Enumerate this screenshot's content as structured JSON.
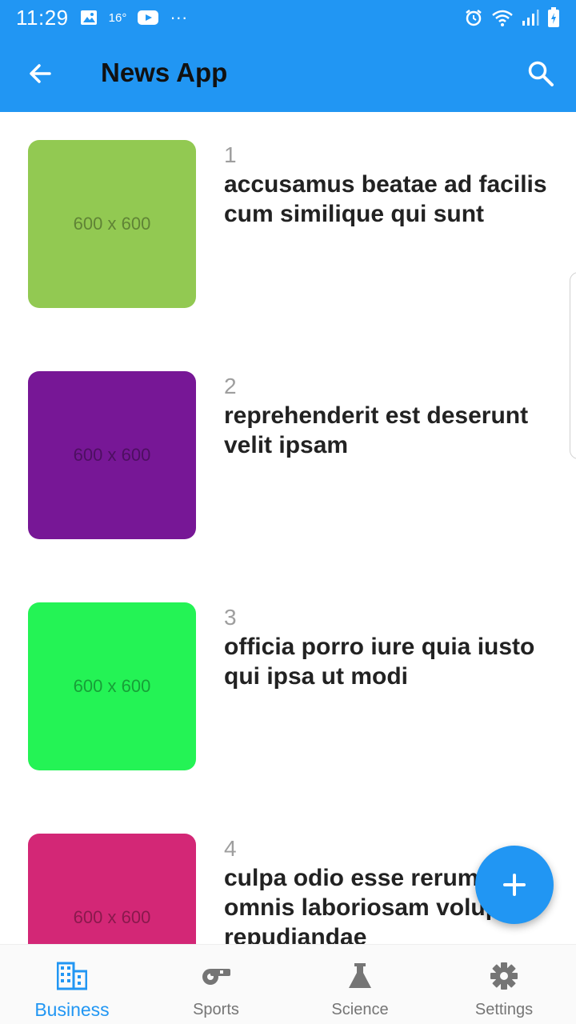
{
  "status_bar": {
    "time": "11:29",
    "temp": "16°",
    "dots": "···"
  },
  "app_bar": {
    "title": "News App"
  },
  "news": [
    {
      "number": "1",
      "title": "accusamus beatae ad facilis cum similique qui sunt",
      "thumb_text": "600 x 600",
      "thumb_color": "#92c952"
    },
    {
      "number": "2",
      "title": "reprehenderit est deserunt velit ipsam",
      "thumb_text": "600 x 600",
      "thumb_color": "#771796"
    },
    {
      "number": "3",
      "title": "officia porro iure quia iusto qui ipsa ut modi",
      "thumb_text": "600 x 600",
      "thumb_color": "#24f355"
    },
    {
      "number": "4",
      "title": "culpa odio esse rerum omnis laboriosam voluptate repudiandae",
      "thumb_text": "600 x 600",
      "thumb_color": "#d32776"
    }
  ],
  "fab": {
    "icon": "plus-icon"
  },
  "bottom_nav": [
    {
      "label": "Business",
      "icon": "business-icon",
      "active": true
    },
    {
      "label": "Sports",
      "icon": "whistle-icon",
      "active": false
    },
    {
      "label": "Science",
      "icon": "flask-icon",
      "active": false
    },
    {
      "label": "Settings",
      "icon": "gear-icon",
      "active": false
    }
  ],
  "colors": {
    "primary": "#2196f3",
    "inactive": "#757575"
  }
}
